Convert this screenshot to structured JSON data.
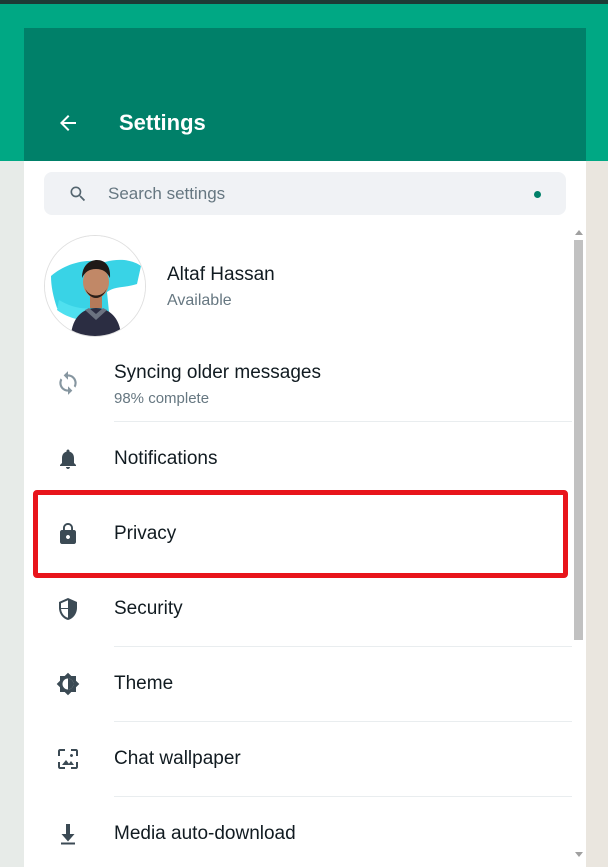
{
  "header": {
    "title": "Settings"
  },
  "search": {
    "placeholder": "Search settings"
  },
  "profile": {
    "name": "Altaf Hassan",
    "status": "Available"
  },
  "sync": {
    "title": "Syncing older messages",
    "subtitle": "98% complete",
    "progress_percent": 98
  },
  "menu": {
    "items": [
      {
        "label": "Notifications",
        "icon": "bell-icon"
      },
      {
        "label": "Privacy",
        "icon": "lock-icon"
      },
      {
        "label": "Security",
        "icon": "shield-icon"
      },
      {
        "label": "Theme",
        "icon": "theme-icon"
      },
      {
        "label": "Chat wallpaper",
        "icon": "wallpaper-icon"
      },
      {
        "label": "Media auto-download",
        "icon": "download-icon"
      }
    ]
  },
  "colors": {
    "header_bg": "#008069",
    "accent": "#00a884",
    "highlight_border": "#e8141b",
    "icon_color": "#3b4a54"
  }
}
